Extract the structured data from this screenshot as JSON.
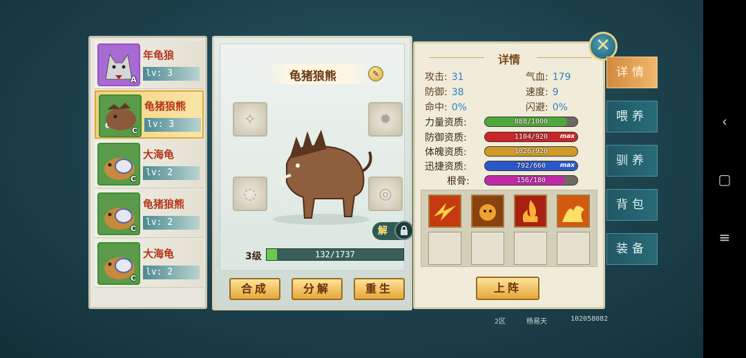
{
  "pet_list": [
    {
      "name": "年龟狼",
      "level_text": "lv: 3",
      "grade": "A",
      "frame": "purple"
    },
    {
      "name": "龟猪狼熊",
      "level_text": "lv: 3",
      "grade": "C",
      "frame": "green",
      "selected": true
    },
    {
      "name": "大海龟",
      "level_text": "lv: 2",
      "grade": "C",
      "frame": "green"
    },
    {
      "name": "龟猪狼熊",
      "level_text": "lv: 2",
      "grade": "C",
      "frame": "green"
    },
    {
      "name": "大海龟",
      "level_text": "lv: 2",
      "grade": "C",
      "frame": "green"
    }
  ],
  "pet_view": {
    "name": "龟猪狼熊",
    "unlock_label": "解",
    "level_label": "3级",
    "exp_text": "132/1737",
    "exp_fraction": 0.076,
    "buttons": {
      "synthesize": "合成",
      "decompose": "分解",
      "rebirth": "重生"
    }
  },
  "details": {
    "title": "详情",
    "stats": [
      {
        "label": "攻击:",
        "value": "31"
      },
      {
        "label": "气血:",
        "value": "179"
      },
      {
        "label": "防御:",
        "value": "38"
      },
      {
        "label": "速度:",
        "value": "9"
      },
      {
        "label": "命中:",
        "value": "0%"
      },
      {
        "label": "闪避:",
        "value": "0%"
      }
    ],
    "aptitudes": [
      {
        "label": "力量资质:",
        "text": "888/1000",
        "fraction": 0.888,
        "color": "#4fa83a",
        "max": ""
      },
      {
        "label": "防御资质:",
        "text": "1104/920",
        "fraction": 1.0,
        "color": "#c8262a",
        "max": "max"
      },
      {
        "label": "体魄资质:",
        "text": "1026/920",
        "fraction": 1.0,
        "color": "#d09a2a",
        "max": ""
      },
      {
        "label": "迅捷资质:",
        "text": "792/660",
        "fraction": 1.0,
        "color": "#2a58c8",
        "max": "max"
      },
      {
        "label": "根骨:",
        "text": "156/180",
        "fraction": 0.867,
        "color": "#c02aa8",
        "max": ""
      }
    ],
    "deploy_label": "上阵"
  },
  "side_tabs": [
    {
      "label": "详情",
      "active": true
    },
    {
      "label": "喂养",
      "active": false
    },
    {
      "label": "驯养",
      "active": false
    },
    {
      "label": "背包",
      "active": false
    },
    {
      "label": "装备",
      "active": false
    }
  ],
  "footer": {
    "server": "2区",
    "player": "杨易天",
    "id": "102058082"
  }
}
